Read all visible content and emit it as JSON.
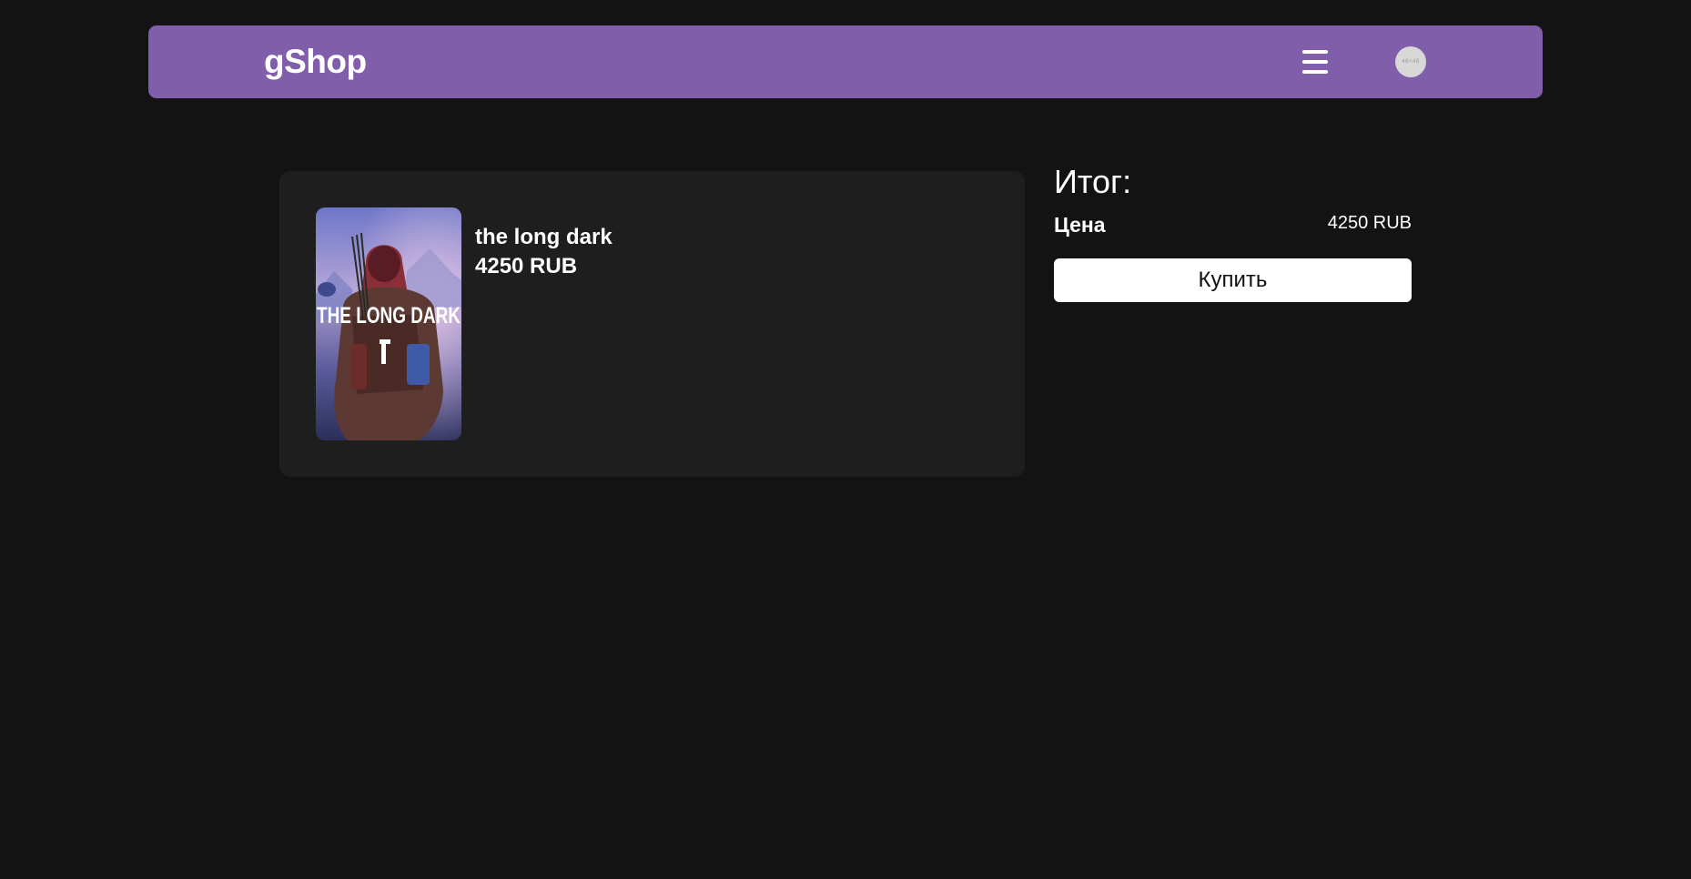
{
  "header": {
    "logo": "gShop",
    "menu_icon": "hamburger-menu-icon",
    "avatar_icon": "user-avatar-icon",
    "avatar_text": "48×48",
    "background_color": "#805eaa"
  },
  "cart": {
    "items": [
      {
        "title": "the long dark",
        "price": "4250 RUB",
        "cover_text": "THE LONG DARK"
      }
    ]
  },
  "summary": {
    "title": "Итог:",
    "price_label": "Цена",
    "price_value": "4250 RUB",
    "buy_label": "Купить"
  },
  "colors": {
    "page_bg": "#131313",
    "card_bg": "#1e1e1e",
    "accent": "#805eaa",
    "button_bg": "#ffffff"
  }
}
